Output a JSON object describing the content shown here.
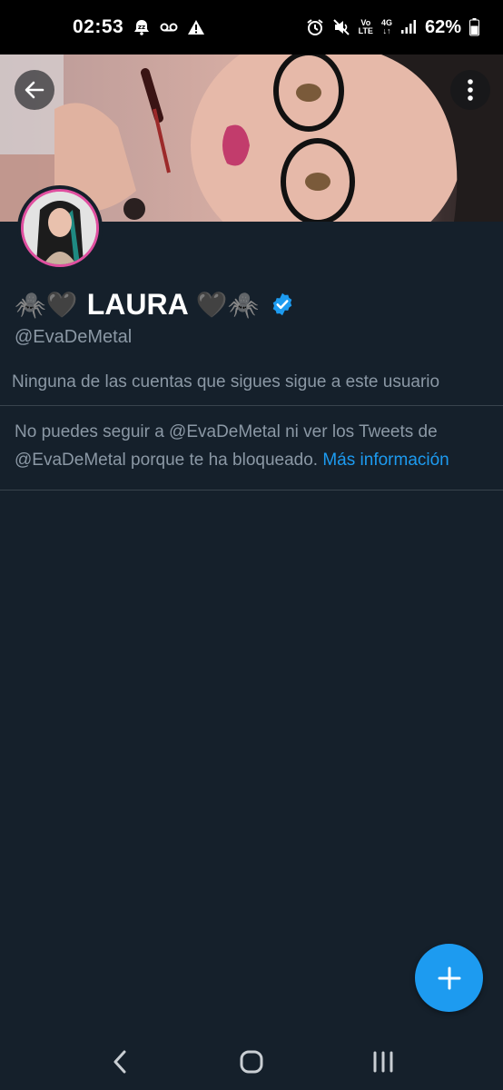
{
  "status_bar": {
    "time": "02:53",
    "left_icons": [
      "snooze-bell-icon",
      "voicemail-icon",
      "warning-icon"
    ],
    "right_icons": [
      "alarm-icon",
      "mute-icon",
      "volte-icon",
      "4g-icon",
      "signal-icon",
      "battery-icon"
    ],
    "volte_line1": "Vo",
    "volte_line2": "LTE",
    "network": "4G",
    "battery": "62%"
  },
  "header": {
    "back_icon": "arrow-left-icon",
    "more_icon": "more-vertical-icon"
  },
  "profile": {
    "emoji_left": "🕷️🖤",
    "name": "LAURA",
    "emoji_right": "🖤🕷️",
    "verified_icon": "verified-badge-icon",
    "handle": "@EvaDeMetal",
    "followers_note": "Ninguna de las cuentas que sigues sigue a este usuario",
    "blocked_message": "No puedes seguir a @EvaDeMetal ni ver los Tweets de @EvaDeMetal porque te ha bloqueado.",
    "more_info_link": "Más información"
  },
  "fab": {
    "icon": "plus-icon"
  },
  "nav": {
    "icons": [
      "back-nav-icon",
      "home-nav-icon",
      "recents-nav-icon"
    ]
  },
  "colors": {
    "background": "#15202b",
    "accent": "#1d9bf0",
    "secondary_text": "#8b98a5",
    "divider": "#38444d",
    "avatar_ring": "#e04fa0"
  }
}
